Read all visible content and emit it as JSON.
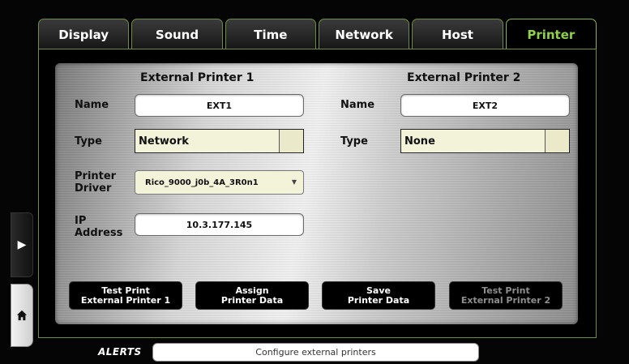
{
  "tabs": [
    {
      "label": "Display"
    },
    {
      "label": "Sound"
    },
    {
      "label": "Time"
    },
    {
      "label": "Network"
    },
    {
      "label": "Host"
    },
    {
      "label": "Printer"
    }
  ],
  "active_tab": "Printer",
  "printer1": {
    "heading": "External Printer 1",
    "name_label": "Name",
    "name_value": "EXT1",
    "type_label": "Type",
    "type_value": "Network",
    "driver_label_1": "Printer",
    "driver_label_2": "Driver",
    "driver_value": "Rico_9000_j0b_4A_3R0n1",
    "ip_label_1": "IP",
    "ip_label_2": "Address",
    "ip_value": "10.3.177.145"
  },
  "printer2": {
    "heading": "External Printer 2",
    "name_label": "Name",
    "name_value": "EXT2",
    "type_label": "Type",
    "type_value": "None"
  },
  "actions": [
    {
      "line1": "Test Print",
      "line2": "External Printer 1",
      "enabled": true
    },
    {
      "line1": "Assign",
      "line2": "Printer Data",
      "enabled": true
    },
    {
      "line1": "Save",
      "line2": "Printer Data",
      "enabled": true
    },
    {
      "line1": "Test Print",
      "line2": "External Printer 2",
      "enabled": false
    }
  ],
  "alerts": {
    "label": "ALERTS",
    "message": "Configure external printers"
  },
  "colors": {
    "accent_green": "#8fd14a",
    "frame_green": "#6f8c42"
  },
  "icons": {
    "side_arrow": "play-right-icon",
    "home": "home-icon"
  }
}
